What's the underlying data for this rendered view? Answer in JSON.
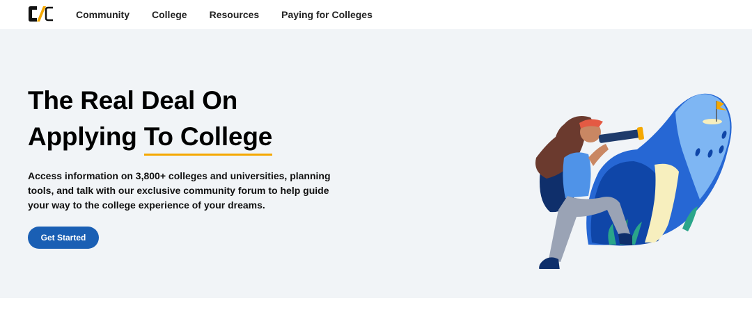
{
  "nav": {
    "logo_alt": "C/C",
    "items": [
      {
        "label": "Community"
      },
      {
        "label": "College"
      },
      {
        "label": "Resources"
      },
      {
        "label": "Paying for Colleges"
      }
    ]
  },
  "hero": {
    "headline_line1": "The Real Deal On",
    "headline_line2_prefix": "Applying ",
    "headline_line2_highlight": "To College",
    "subtext": "Access information on 3,800+ colleges and universities, planning tools, and talk with our exclusive community forum to help guide your way to the college experience of your dreams.",
    "cta_label": "Get Started",
    "illustration_icon": "explorer-with-telescope-illustration"
  },
  "colors": {
    "accent_underline": "#f5a800",
    "cta_background": "#1a5fb4",
    "hero_background": "#f1f4f7"
  }
}
